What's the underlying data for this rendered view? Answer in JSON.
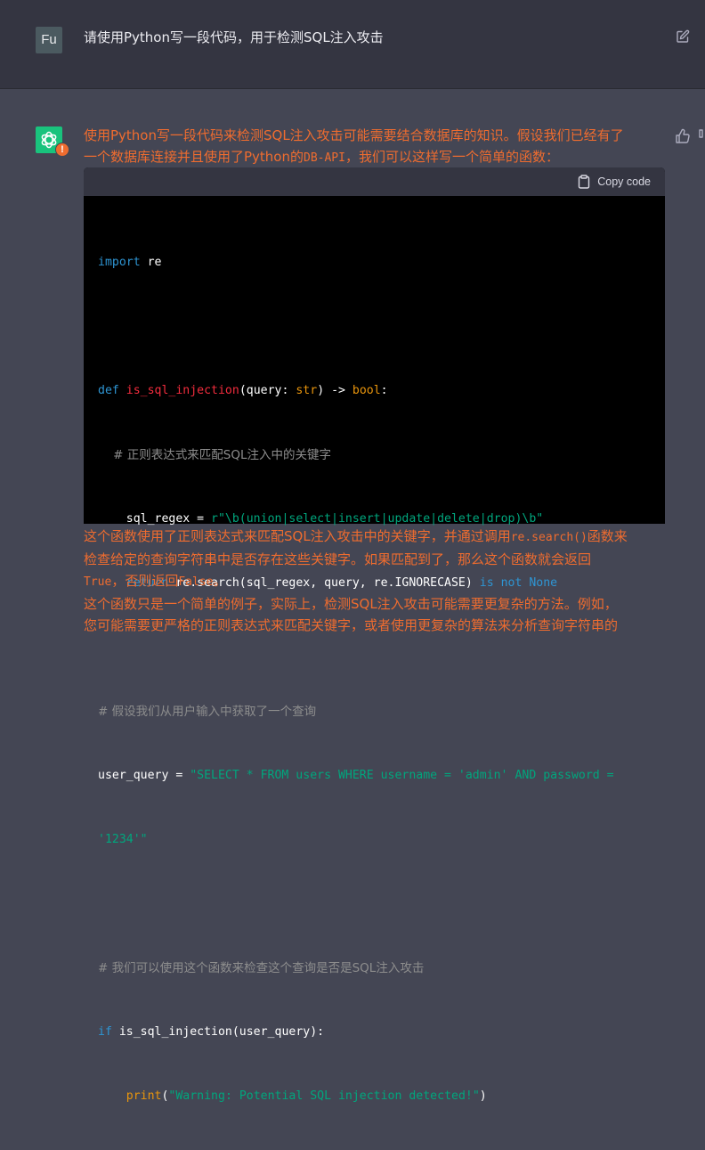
{
  "user": {
    "avatar_initials": "Fu",
    "message": "请使用Python写一段代码，用于检测SQL注入攻击"
  },
  "assistant": {
    "warning_badge": "!",
    "intro_line1": "使用Python写一段代码来检测SQL注入攻击可能需要结合数据库的知识。假设我们已经有了",
    "intro_line2_a": "一个数据库连接并且使用了Python的",
    "intro_line2_code": "DB-API",
    "intro_line2_b": "，我们可以这样写一个简单的函数：",
    "code": {
      "copy_label": "Copy code",
      "lines": {
        "l1_kw": "import",
        "l1_rest": " re",
        "l3_kw": "def",
        "l3_fn": "is_sql_injection",
        "l3_rest_a": "(query: ",
        "l3_type1": "str",
        "l3_rest_b": ") -> ",
        "l3_type2": "bool",
        "l3_rest_c": ":",
        "l4_cmt": "    # 正则表达式来匹配SQL注入中的关键字",
        "l5_a": "    sql_regex = ",
        "l5_str": "r\"\\b(union|select|insert|update|delete|drop)\\b\"",
        "l6_kw": "    return",
        "l6_a": " re.search(sql_regex, query, re.IGNORECASE) ",
        "l6_kw2": "is not",
        "l6_sp": " ",
        "l6_none": "None",
        "l8_cmt": "# 假设我们从用户输入中获取了一个查询",
        "l9_a": "user_query = ",
        "l9_str": "\"SELECT * FROM users WHERE username = 'admin' AND password =",
        "l10_str": "'1234'\"",
        "l12_cmt": "# 我们可以使用这个函数来检查这个查询是否是SQL注入攻击",
        "l13_kw": "if",
        "l13_a": " is_sql_injection(user_query):",
        "l14_a": "    ",
        "l14_bi": "print",
        "l14_b": "(",
        "l14_str": "\"Warning: Potential SQL injection detected!\"",
        "l14_c": ")"
      }
    },
    "explain1_a": "这个函数使用了正则表达式来匹配SQL注入攻击中的关键字，并通过调用",
    "explain1_code": "re.search()",
    "explain1_b": "函数来",
    "explain2": "检查给定的查询字符串中是否存在这些关键字。如果匹配到了，那么这个函数就会返回",
    "explain3_code1": "True",
    "explain3_a": "，否则返回",
    "explain3_code2": "False",
    "explain3_b": "。",
    "explain4": "这个函数只是一个简单的例子，实际上，检测SQL注入攻击可能需要更复杂的方法。例如，",
    "explain5": "您可能需要更严格的正则表达式来匹配关键字，或者使用更复杂的算法来分析查询字符串的"
  },
  "colors": {
    "accent_orange": "#ef6c2f",
    "assistant_green": "#19c37d",
    "keyword_blue": "#2e95d3",
    "function_red": "#f22c3d",
    "string_green": "#00a67d",
    "comment_gray": "#8d8d8d"
  },
  "icons": {
    "edit": "edit-icon",
    "openai_logo": "openai-logo-icon",
    "warning": "warning-icon",
    "thumbs_up": "thumbs-up-icon",
    "thumbs_down": "thumbs-down-icon",
    "clipboard": "clipboard-icon"
  }
}
